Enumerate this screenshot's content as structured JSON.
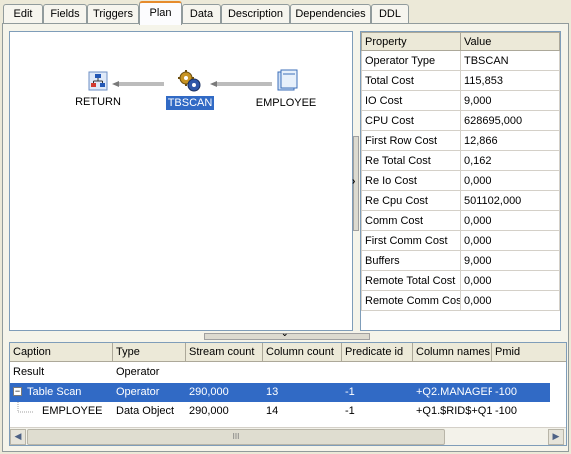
{
  "tabs": [
    "Edit",
    "Fields",
    "Triggers",
    "Plan",
    "Data",
    "Description",
    "Dependencies",
    "DDL"
  ],
  "active_tab": "Plan",
  "plan": {
    "nodes": {
      "return": "RETURN",
      "tbscan": "TBSCAN",
      "employee": "EMPLOYEE"
    }
  },
  "properties": {
    "headers": {
      "property": "Property",
      "value": "Value"
    },
    "rows": [
      {
        "p": "Operator Type",
        "v": "TBSCAN"
      },
      {
        "p": "Total Cost",
        "v": "115,853"
      },
      {
        "p": "IO Cost",
        "v": "9,000"
      },
      {
        "p": "CPU Cost",
        "v": "628695,000"
      },
      {
        "p": "First Row Cost",
        "v": "12,866"
      },
      {
        "p": "Re Total Cost",
        "v": "0,162"
      },
      {
        "p": "Re Io Cost",
        "v": "0,000"
      },
      {
        "p": "Re Cpu Cost",
        "v": "501102,000"
      },
      {
        "p": "Comm Cost",
        "v": "0,000"
      },
      {
        "p": "First Comm Cost",
        "v": "0,000"
      },
      {
        "p": "Buffers",
        "v": "9,000"
      },
      {
        "p": "Remote Total Cost",
        "v": "0,000"
      },
      {
        "p": "Remote Comm Cost",
        "v": "0,000"
      }
    ]
  },
  "grid": {
    "columns": [
      "Caption",
      "Type",
      "Stream count",
      "Column count",
      "Predicate id",
      "Column names",
      "Pmid"
    ],
    "rows": [
      [
        "Result",
        "Operator",
        "",
        "",
        "",
        "",
        ""
      ],
      [
        "Table Scan",
        "Operator",
        "290,000",
        "13",
        "-1",
        "+Q2.MANAGEF",
        "-100"
      ],
      [
        "EMPLOYEE",
        "Data Object",
        "290,000",
        "14",
        "-1",
        "+Q1.$RID$+Q1",
        "-100"
      ]
    ],
    "expand_glyph": "−",
    "scroll_thumb_glyph": "III"
  },
  "icons": {
    "left_arrow": "◀",
    "right_arrow": "▶",
    "splitter_right": "›",
    "splitter_down": "⌄"
  },
  "colors": {
    "selection": "#316ac5",
    "active_tab_accent": "#e68b2c"
  }
}
